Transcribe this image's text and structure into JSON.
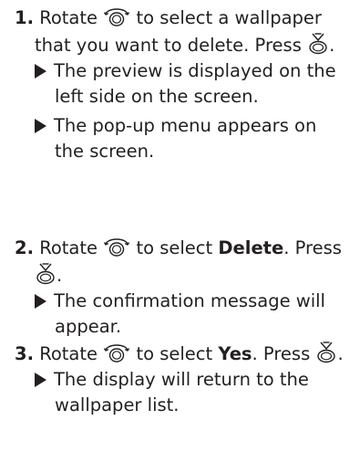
{
  "steps": [
    {
      "number": "1.",
      "line1_prefix": "Rotate",
      "line1_suffix": "to select a wallpaper",
      "line2_prefix": "that you want to delete. Press",
      "line2_suffix": ".",
      "notes": [
        {
          "line1": "The preview is displayed on the",
          "line2": "left side on the screen."
        },
        {
          "line1": "The pop-up menu appears on",
          "line2": "the screen."
        }
      ]
    },
    {
      "number": "2.",
      "line1_prefix": "Rotate",
      "line1_middle": "to select",
      "line1_bold": "Delete",
      "line1_suffix": ". Press",
      "line2_suffix": ".",
      "notes": [
        {
          "line1": "The confirmation message will",
          "line2": "appear."
        }
      ]
    },
    {
      "number": "3.",
      "line1_prefix": "Rotate",
      "line1_middle": "to select",
      "line1_bold": "Yes",
      "line1_suffix": ". Press",
      "line1_end": ".",
      "notes": [
        {
          "line1": "The display will return to the",
          "line2": "wallpaper list."
        }
      ]
    }
  ],
  "icons": {
    "rotate": "interface-dial-rotate-icon",
    "press": "interface-dial-press-icon"
  }
}
